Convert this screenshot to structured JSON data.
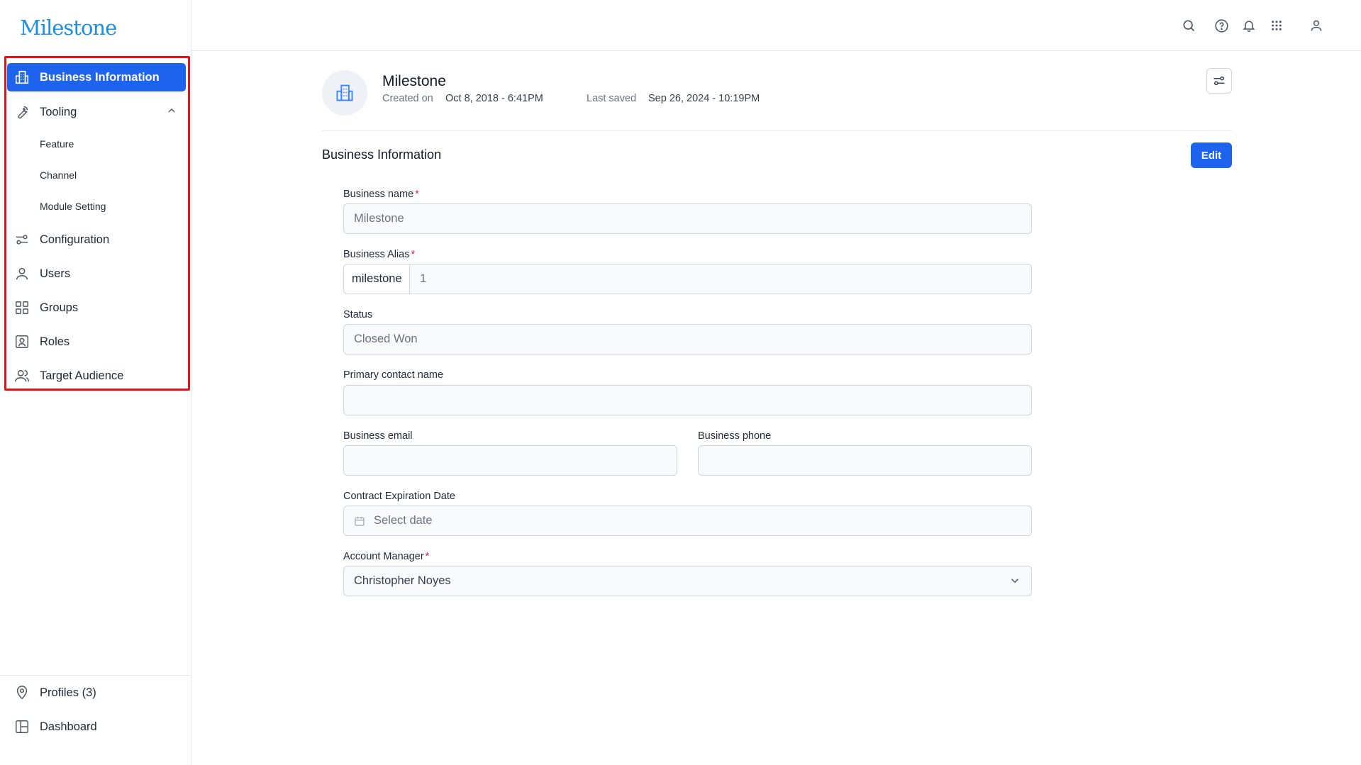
{
  "brand": {
    "logo": "Milestone"
  },
  "sidebar": {
    "items": [
      {
        "label": "Business Information",
        "icon": "building-icon",
        "active": true
      },
      {
        "label": "Tooling",
        "icon": "wrench-icon",
        "expanded": true
      },
      {
        "label": "Configuration",
        "icon": "sliders-icon"
      },
      {
        "label": "Users",
        "icon": "user-icon"
      },
      {
        "label": "Groups",
        "icon": "grid-icon"
      },
      {
        "label": "Roles",
        "icon": "id-card-icon"
      },
      {
        "label": "Target Audience",
        "icon": "users-icon"
      }
    ],
    "tooling_sub": [
      "Feature",
      "Channel",
      "Module Setting"
    ],
    "bottom": [
      {
        "label": "Profiles (3)",
        "icon": "location-pin-icon"
      },
      {
        "label": "Dashboard",
        "icon": "dashboard-icon"
      }
    ],
    "highlight_color": "#e3121b"
  },
  "topbar": {
    "icons": [
      "search-icon",
      "help-icon",
      "bell-icon",
      "apps-grid-icon",
      "profile-icon"
    ]
  },
  "header": {
    "company_name": "Milestone",
    "created_label": "Created on",
    "created_value": "Oct 8, 2018 - 6:41PM",
    "saved_label": "Last saved",
    "saved_value": "Sep 26, 2024 - 10:19PM"
  },
  "section": {
    "title": "Business Information",
    "edit_label": "Edit"
  },
  "form": {
    "business_name": {
      "label": "Business name",
      "required": "*",
      "value": "Milestone"
    },
    "business_alias": {
      "label": "Business Alias",
      "required": "*",
      "prefix": "milestone",
      "value": "1"
    },
    "status": {
      "label": "Status",
      "value": "Closed Won"
    },
    "primary_contact": {
      "label": "Primary contact name",
      "value": ""
    },
    "business_email": {
      "label": "Business email",
      "value": ""
    },
    "business_phone": {
      "label": "Business phone",
      "value": ""
    },
    "contract_expiration": {
      "label": "Contract Expiration Date",
      "placeholder": "Select date"
    },
    "account_manager": {
      "label": "Account Manager",
      "required": "*",
      "value": "Christopher Noyes"
    }
  },
  "colors": {
    "accent": "#1d63ed",
    "logo": "#1d8fe0",
    "required": "#e11d48"
  }
}
